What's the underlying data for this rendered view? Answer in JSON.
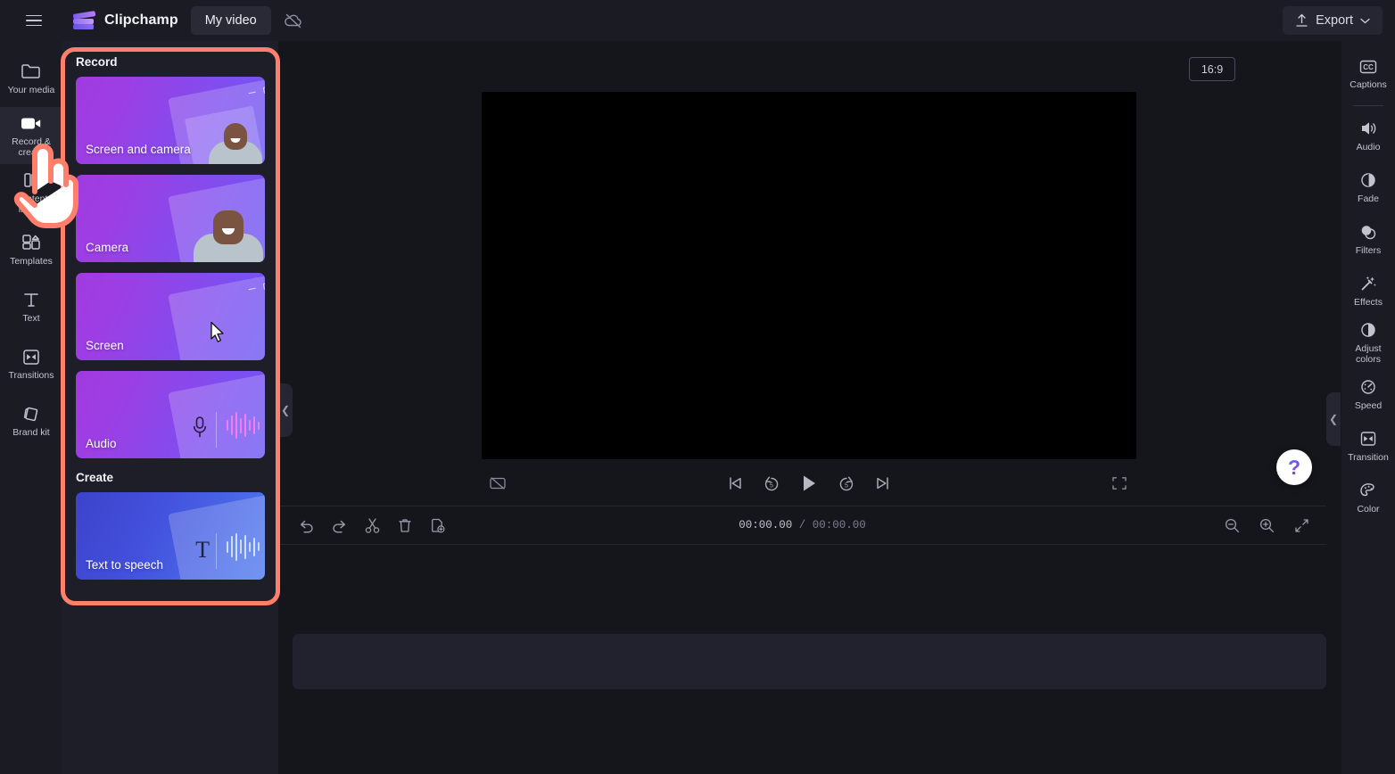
{
  "app": {
    "brand_name": "Clipchamp",
    "project_title": "My video",
    "menu_icon": "hamburger-icon",
    "cloud_icon": "cloud-off-icon",
    "logo_icon": "clipchamp-logo-icon"
  },
  "topbar": {
    "export_label": "Export",
    "export_icon": "upload-icon",
    "export_chevron": "chevron-down-icon"
  },
  "sidebar": {
    "items": [
      {
        "label": "Your media",
        "icon": "folder-icon",
        "active": false
      },
      {
        "label": "Record & create",
        "icon": "video-camera-icon",
        "active": true
      },
      {
        "label": "Content library",
        "icon": "library-icon",
        "active": false
      },
      {
        "label": "Templates",
        "icon": "templates-icon",
        "active": false
      },
      {
        "label": "Text",
        "icon": "text-icon",
        "active": false
      },
      {
        "label": "Transitions",
        "icon": "transitions-icon",
        "active": false
      },
      {
        "label": "Brand kit",
        "icon": "brand-kit-icon",
        "active": false
      }
    ]
  },
  "panel": {
    "section_record": "Record",
    "section_create": "Create",
    "record_cards": [
      {
        "label": "Screen and camera",
        "style": "purple",
        "art": "screen-camera"
      },
      {
        "label": "Camera",
        "style": "purple",
        "art": "camera"
      },
      {
        "label": "Screen",
        "style": "purple",
        "art": "screen"
      },
      {
        "label": "Audio",
        "style": "purple",
        "art": "audio"
      }
    ],
    "create_cards": [
      {
        "label": "Text to speech",
        "style": "blue",
        "art": "tts"
      }
    ],
    "collapse_icon": "chevron-left-icon",
    "highlight_color": "#ff7f6b"
  },
  "stage": {
    "aspect_ratio": "16:9",
    "video_background": "#000000",
    "controls": [
      {
        "name": "captions-off-button",
        "icon": "captions-off-icon"
      },
      {
        "name": "skip-to-start-button",
        "icon": "skip-start-icon"
      },
      {
        "name": "rewind-5s-button",
        "icon": "rewind-5-icon",
        "value": "5"
      },
      {
        "name": "play-button",
        "icon": "play-icon"
      },
      {
        "name": "forward-5s-button",
        "icon": "forward-5-icon",
        "value": "5"
      },
      {
        "name": "skip-to-end-button",
        "icon": "skip-end-icon"
      },
      {
        "name": "fullscreen-button",
        "icon": "fullscreen-icon"
      }
    ]
  },
  "timeline": {
    "current_time": "00:00.00",
    "separator": "/",
    "total_time": "00:00.00",
    "tools": [
      {
        "name": "undo-button",
        "icon": "undo-icon"
      },
      {
        "name": "redo-button",
        "icon": "redo-icon"
      },
      {
        "name": "split-button",
        "icon": "scissors-icon"
      },
      {
        "name": "delete-button",
        "icon": "trash-icon"
      },
      {
        "name": "duplicate-button",
        "icon": "duplicate-icon"
      }
    ],
    "zoom_controls": [
      {
        "name": "zoom-out-button",
        "icon": "zoom-out-icon"
      },
      {
        "name": "zoom-in-button",
        "icon": "zoom-in-icon"
      },
      {
        "name": "fit-to-screen-button",
        "icon": "fit-screen-icon"
      }
    ]
  },
  "right_sidebar": {
    "items": [
      {
        "label": "Captions",
        "icon": "captions-icon"
      },
      {
        "label": "Audio",
        "icon": "speaker-icon"
      },
      {
        "label": "Fade",
        "icon": "fade-icon"
      },
      {
        "label": "Filters",
        "icon": "filters-icon"
      },
      {
        "label": "Effects",
        "icon": "magic-wand-icon"
      },
      {
        "label": "Adjust colors",
        "icon": "contrast-icon"
      },
      {
        "label": "Speed",
        "icon": "speedometer-icon"
      },
      {
        "label": "Transition",
        "icon": "transition-icon"
      },
      {
        "label": "Color",
        "icon": "palette-icon"
      }
    ],
    "collapse_icon": "chevron-left-icon"
  },
  "help": {
    "label": "?",
    "icon": "help-icon"
  },
  "cursor": {
    "icon": "pointing-hand-cursor"
  }
}
